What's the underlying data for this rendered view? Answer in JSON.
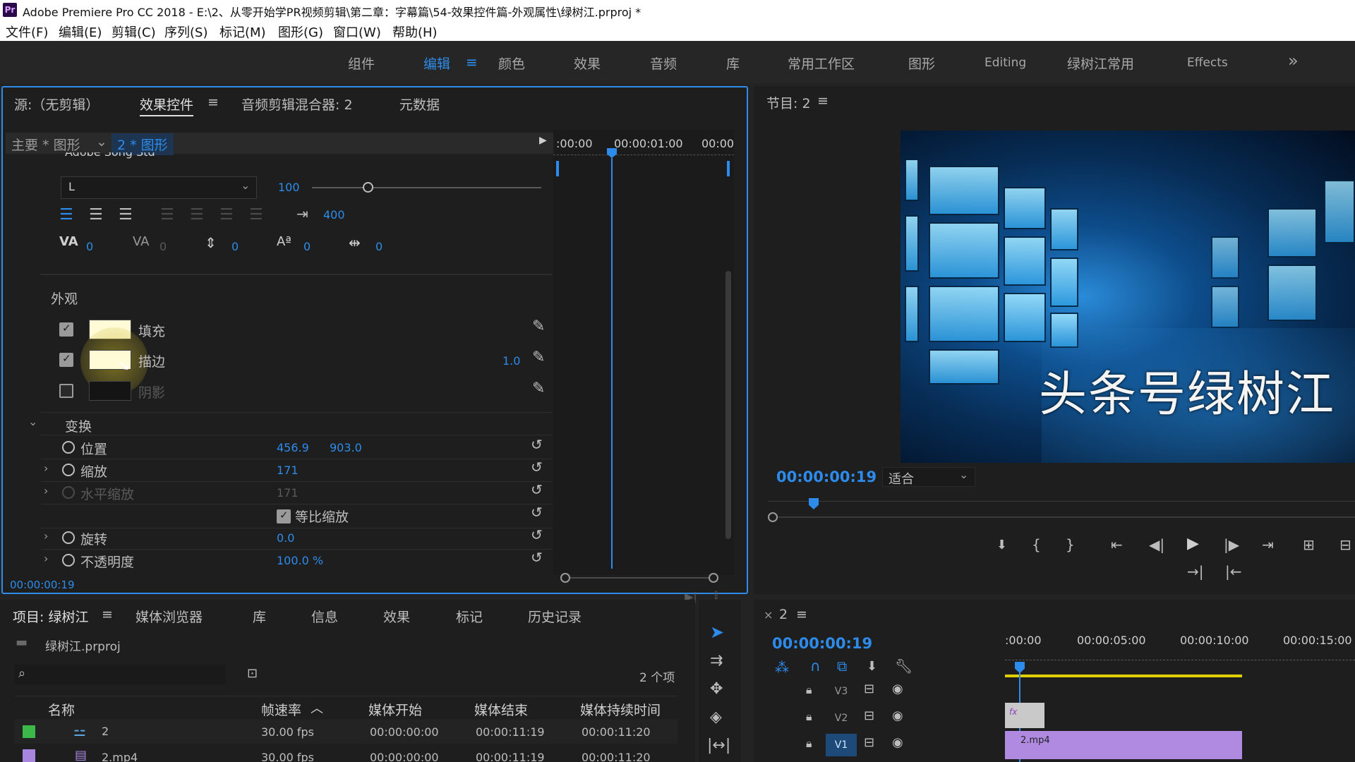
{
  "titlebar": {
    "title": "Adobe Premiere Pro CC 2018 - E:\\2、从零开始学PR视频剪辑\\第二章：字幕篇\\54-效果控件篇-外观属性\\绿树江.prproj *",
    "logo": "Pr"
  },
  "menu": [
    "文件(F)",
    "编辑(E)",
    "剪辑(C)",
    "序列(S)",
    "标记(M)",
    "图形(G)",
    "窗口(W)",
    "帮助(H)"
  ],
  "workspaces": [
    "组件",
    "编辑",
    "颜色",
    "效果",
    "音频",
    "库",
    "常用工作区",
    "图形",
    "Editing",
    "绿树江常用",
    "Effects"
  ],
  "ws_overflow": "»",
  "effect_panel": {
    "tabs": [
      "源:（无剪辑）",
      "效果控件",
      "音频剪辑混合器: 2",
      "元数据"
    ],
    "menu_icon": "≡",
    "crumb_main": "主要 * 图形",
    "crumb_clip": "2 * 图形",
    "font_name": "Adobe Song Std",
    "font_style": "L",
    "font_size": "100",
    "tab_width": "400",
    "kerning": [
      "0",
      "0",
      "0",
      "0",
      "0"
    ],
    "appearance_label": "外观",
    "fill_label": "填充",
    "stroke_label": "描边",
    "stroke_width": "1.0",
    "shadow_label": "阴影",
    "transform_label": "变换",
    "position_label": "位置",
    "position_x": "456.9",
    "position_y": "903.0",
    "scale_label": "缩放",
    "scale_value": "171",
    "hscale_label": "水平缩放",
    "hscale_value": "171",
    "uniform_label": "等比缩放",
    "rotation_label": "旋转",
    "rotation_value": "0.0",
    "opacity_label": "不透明度",
    "opacity_value": "100.0 %",
    "timecode": "00:00:00:19",
    "ruler": [
      ":00:00",
      "00:00:01:00",
      "00:00"
    ],
    "colors": {
      "fill": "#fffbd6",
      "stroke": "#fffbd6",
      "shadow": "#141414"
    }
  },
  "program": {
    "title": "节目: 2",
    "timecode": "00:00:00:19",
    "fit": "适合",
    "overlay_text": "头条号绿树江"
  },
  "project": {
    "tabs": [
      "项目: 绿树江",
      "媒体浏览器",
      "库",
      "信息",
      "效果",
      "标记",
      "历史记录"
    ],
    "filename": "绿树江.prproj",
    "count": "2 个项",
    "columns": [
      "名称",
      "帧速率",
      "媒体开始",
      "媒体结束",
      "媒体持续时间"
    ],
    "rows": [
      {
        "name": "2",
        "fps": "30.00 fps",
        "start": "00:00:00:00",
        "end": "00:00:11:19",
        "dur": "00:00:11:20",
        "color": "#3cb84b"
      },
      {
        "name": "2.mp4",
        "fps": "30.00 fps",
        "start": "00:00:00:00",
        "end": "00:00:11:19",
        "dur": "00:00:11:20",
        "color": "#a886e0"
      }
    ]
  },
  "timeline": {
    "close": "×",
    "seq": "2",
    "timecode": "00:00:00:19",
    "ruler": [
      ":00:00",
      "00:00:05:00",
      "00:00:10:00",
      "00:00:15:00"
    ],
    "tracks": [
      "V3",
      "V2",
      "V1"
    ],
    "clip_v1": "2.mp4",
    "clip_v2": "fx"
  }
}
